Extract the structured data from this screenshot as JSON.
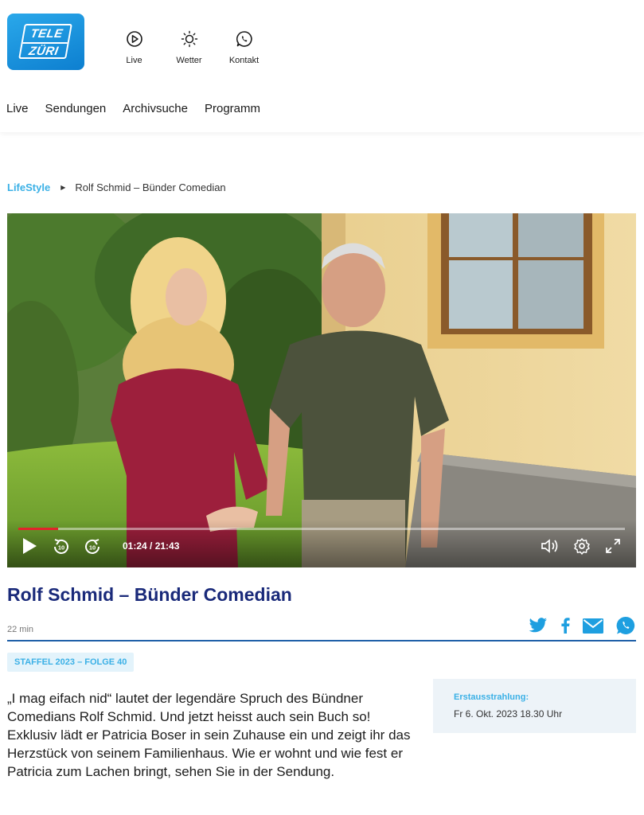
{
  "logo": {
    "line1": "TELE",
    "line2": "ZÜRI"
  },
  "topnav": [
    {
      "label": "Live",
      "icon": "play-circle-icon"
    },
    {
      "label": "Wetter",
      "icon": "sun-icon"
    },
    {
      "label": "Kontakt",
      "icon": "whatsapp-icon"
    }
  ],
  "mainnav": [
    "Live",
    "Sendungen",
    "Archivsuche",
    "Programm"
  ],
  "breadcrumb": {
    "parent": "LifeStyle",
    "current": "Rolf Schmid – Bünder Comedian"
  },
  "video": {
    "time": "01:24 / 21:43",
    "progress": 0.065,
    "controls": [
      "play-icon",
      "rewind-10-icon",
      "forward-10-icon",
      "volume-icon",
      "settings-icon",
      "fullscreen-icon"
    ]
  },
  "episode": {
    "title": "Rolf Schmid – Bünder Comedian",
    "duration": "22 min",
    "season": "STAFFEL 2023 – FOLGE 40",
    "description": "„I mag eifach nid“ lautet der legendäre Spruch des Bündner Comedians Rolf Schmid. Und jetzt heisst auch sein Buch so! Exklusiv lädt er Patricia Boser in sein Zuhause ein und zeigt ihr das Herzstück von seinem Familienhaus. Wie er wohnt und wie fest er Patricia zum Lachen bringt, sehen Sie in der Sendung."
  },
  "share": [
    "twitter-icon",
    "facebook-icon",
    "mail-icon",
    "whatsapp-icon"
  ],
  "first_air": {
    "label": "Erstausstrahlung:",
    "value": "Fr 6. Okt. 2023 18.30 Uhr"
  },
  "colors": {
    "brand_blue": "#1a9ae0",
    "title_navy": "#1a2a7a",
    "accent_cyan": "#3ab0e6",
    "progress_red": "#e0252b"
  }
}
